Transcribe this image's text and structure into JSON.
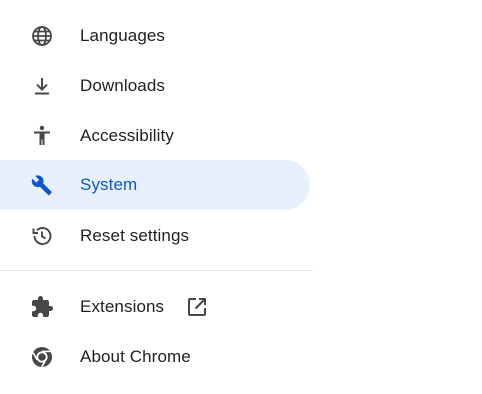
{
  "colors": {
    "icon": "#474747",
    "text": "#1f1f1f",
    "selected_bg": "#e8effd",
    "selected_fg": "#0b57d0",
    "divider": "#e3e3e3"
  },
  "sidebar": {
    "items": [
      {
        "label": "Languages",
        "icon": "globe-icon",
        "selected": false
      },
      {
        "label": "Downloads",
        "icon": "download-icon",
        "selected": false
      },
      {
        "label": "Accessibility",
        "icon": "accessibility-icon",
        "selected": false
      },
      {
        "label": "System",
        "icon": "wrench-icon",
        "selected": true
      },
      {
        "label": "Reset settings",
        "icon": "reset-history-icon",
        "selected": false
      }
    ],
    "bottom_items": [
      {
        "label": "Extensions",
        "icon": "puzzle-piece-icon",
        "trailing_icon": "open-in-new-icon"
      },
      {
        "label": "About Chrome",
        "icon": "chrome-logo-icon"
      }
    ]
  }
}
